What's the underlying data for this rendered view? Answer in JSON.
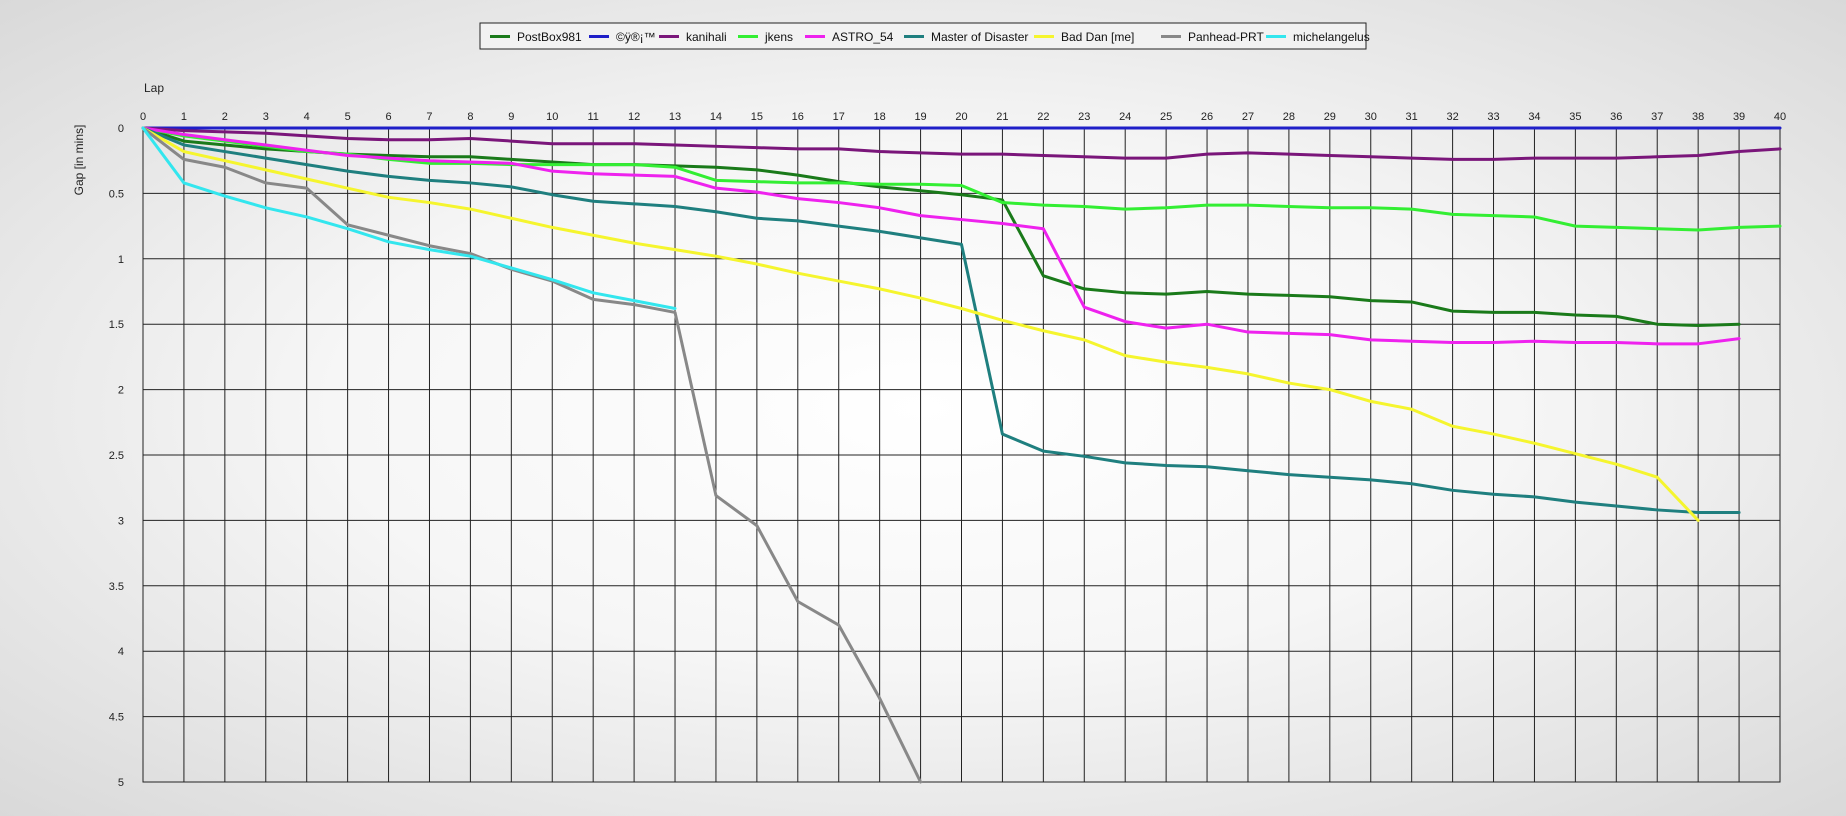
{
  "chart_data": {
    "type": "line",
    "xlabel": "Lap",
    "ylabel": "Gap [in mins]",
    "xlim": [
      0,
      40
    ],
    "ylim": [
      0,
      5
    ],
    "y_inverted": true,
    "grid": true,
    "legend_position": "top-center",
    "x_ticks": [
      0,
      1,
      2,
      3,
      4,
      5,
      6,
      7,
      8,
      9,
      10,
      11,
      12,
      13,
      14,
      15,
      16,
      17,
      18,
      19,
      20,
      21,
      22,
      23,
      24,
      25,
      26,
      27,
      28,
      29,
      30,
      31,
      32,
      33,
      34,
      35,
      36,
      37,
      38,
      39,
      40
    ],
    "y_ticks": [
      {
        "value": 0,
        "label": "0"
      },
      {
        "value": 0.5,
        "label": "0.5"
      },
      {
        "value": 1,
        "label": "1"
      },
      {
        "value": 1.5,
        "label": "1.5"
      },
      {
        "value": 2,
        "label": "2"
      },
      {
        "value": 2.5,
        "label": "2.5"
      },
      {
        "value": 3,
        "label": "3"
      },
      {
        "value": 3.5,
        "label": "3.5"
      },
      {
        "value": 4,
        "label": "4"
      },
      {
        "value": 4.5,
        "label": "4.5"
      },
      {
        "value": 5,
        "label": "5"
      }
    ],
    "series": [
      {
        "name": "PostBox981",
        "color": "#1a7a1a",
        "x_start": 0,
        "values": [
          0,
          0.1,
          0.13,
          0.16,
          0.18,
          0.2,
          0.21,
          0.22,
          0.22,
          0.24,
          0.26,
          0.28,
          0.28,
          0.29,
          0.3,
          0.32,
          0.36,
          0.41,
          0.45,
          0.48,
          0.51,
          0.55,
          1.13,
          1.23,
          1.26,
          1.27,
          1.25,
          1.27,
          1.28,
          1.29,
          1.32,
          1.33,
          1.4,
          1.41,
          1.41,
          1.43,
          1.44,
          1.5,
          1.51,
          1.5
        ]
      },
      {
        "name": "©ÿ®¡™",
        "color": "#1f1fc8",
        "x_start": 0,
        "values": [
          0,
          0,
          0,
          0,
          0,
          0,
          0,
          0,
          0,
          0,
          0,
          0,
          0,
          0,
          0,
          0,
          0,
          0,
          0,
          0,
          0,
          0,
          0,
          0,
          0,
          0,
          0,
          0,
          0,
          0,
          0,
          0,
          0,
          0,
          0,
          0,
          0,
          0,
          0,
          0,
          0
        ]
      },
      {
        "name": "kanihali",
        "color": "#7a167a",
        "x_start": 0,
        "values": [
          0,
          0.02,
          0.03,
          0.04,
          0.06,
          0.08,
          0.09,
          0.09,
          0.08,
          0.1,
          0.12,
          0.12,
          0.12,
          0.13,
          0.14,
          0.15,
          0.16,
          0.16,
          0.18,
          0.19,
          0.2,
          0.2,
          0.21,
          0.22,
          0.23,
          0.23,
          0.2,
          0.19,
          0.2,
          0.21,
          0.22,
          0.23,
          0.24,
          0.24,
          0.23,
          0.23,
          0.23,
          0.22,
          0.21,
          0.18,
          0.16
        ]
      },
      {
        "name": "jkens",
        "color": "#33ee33",
        "x_start": 0,
        "values": [
          0,
          0.06,
          0.1,
          0.14,
          0.18,
          0.2,
          0.24,
          0.27,
          0.27,
          0.28,
          0.28,
          0.28,
          0.28,
          0.3,
          0.4,
          0.41,
          0.42,
          0.42,
          0.43,
          0.43,
          0.44,
          0.57,
          0.59,
          0.6,
          0.62,
          0.61,
          0.59,
          0.59,
          0.6,
          0.61,
          0.61,
          0.62,
          0.66,
          0.67,
          0.68,
          0.75,
          0.76,
          0.77,
          0.78,
          0.76,
          0.75
        ]
      },
      {
        "name": "ASTRO_54",
        "color": "#ee22ee",
        "x_start": 0,
        "values": [
          0,
          0.05,
          0.09,
          0.13,
          0.17,
          0.21,
          0.23,
          0.25,
          0.26,
          0.27,
          0.33,
          0.35,
          0.36,
          0.37,
          0.46,
          0.49,
          0.54,
          0.57,
          0.61,
          0.67,
          0.7,
          0.73,
          0.77,
          1.37,
          1.48,
          1.53,
          1.5,
          1.56,
          1.57,
          1.58,
          1.62,
          1.63,
          1.64,
          1.64,
          1.63,
          1.64,
          1.64,
          1.65,
          1.65,
          1.61
        ]
      },
      {
        "name": "Master of Disaster",
        "color": "#1f7f7f",
        "x_start": 0,
        "values": [
          0,
          0.13,
          0.18,
          0.23,
          0.28,
          0.33,
          0.37,
          0.4,
          0.42,
          0.45,
          0.51,
          0.56,
          0.58,
          0.6,
          0.64,
          0.69,
          0.71,
          0.75,
          0.79,
          0.84,
          0.89,
          2.34,
          2.47,
          2.51,
          2.56,
          2.58,
          2.59,
          2.62,
          2.65,
          2.67,
          2.69,
          2.72,
          2.77,
          2.8,
          2.82,
          2.86,
          2.89,
          2.92,
          2.94,
          2.94
        ]
      },
      {
        "name": "Bad Dan [me]",
        "color": "#f5f52e",
        "x_start": 0,
        "values": [
          0,
          0.18,
          0.25,
          0.32,
          0.39,
          0.46,
          0.53,
          0.57,
          0.62,
          0.69,
          0.76,
          0.82,
          0.88,
          0.93,
          0.98,
          1.04,
          1.11,
          1.17,
          1.23,
          1.3,
          1.38,
          1.47,
          1.55,
          1.62,
          1.74,
          1.79,
          1.83,
          1.88,
          1.95,
          2.0,
          2.09,
          2.15,
          2.28,
          2.34,
          2.41,
          2.49,
          2.57,
          2.67,
          3.0
        ]
      },
      {
        "name": "Panhead-PRT",
        "color": "#888888",
        "x_start": 0,
        "values": [
          0,
          0.24,
          0.3,
          0.42,
          0.46,
          0.74,
          0.82,
          0.9,
          0.96,
          1.08,
          1.17,
          1.31,
          1.35,
          1.41,
          2.81,
          3.04,
          3.62,
          3.8,
          4.36,
          5.0
        ]
      },
      {
        "name": "michelangelus",
        "color": "#33e6ee",
        "x_start": 0,
        "values": [
          0,
          0.42,
          0.52,
          0.61,
          0.68,
          0.77,
          0.87,
          0.93,
          0.98,
          1.07,
          1.16,
          1.26,
          1.32,
          1.38
        ]
      }
    ]
  }
}
